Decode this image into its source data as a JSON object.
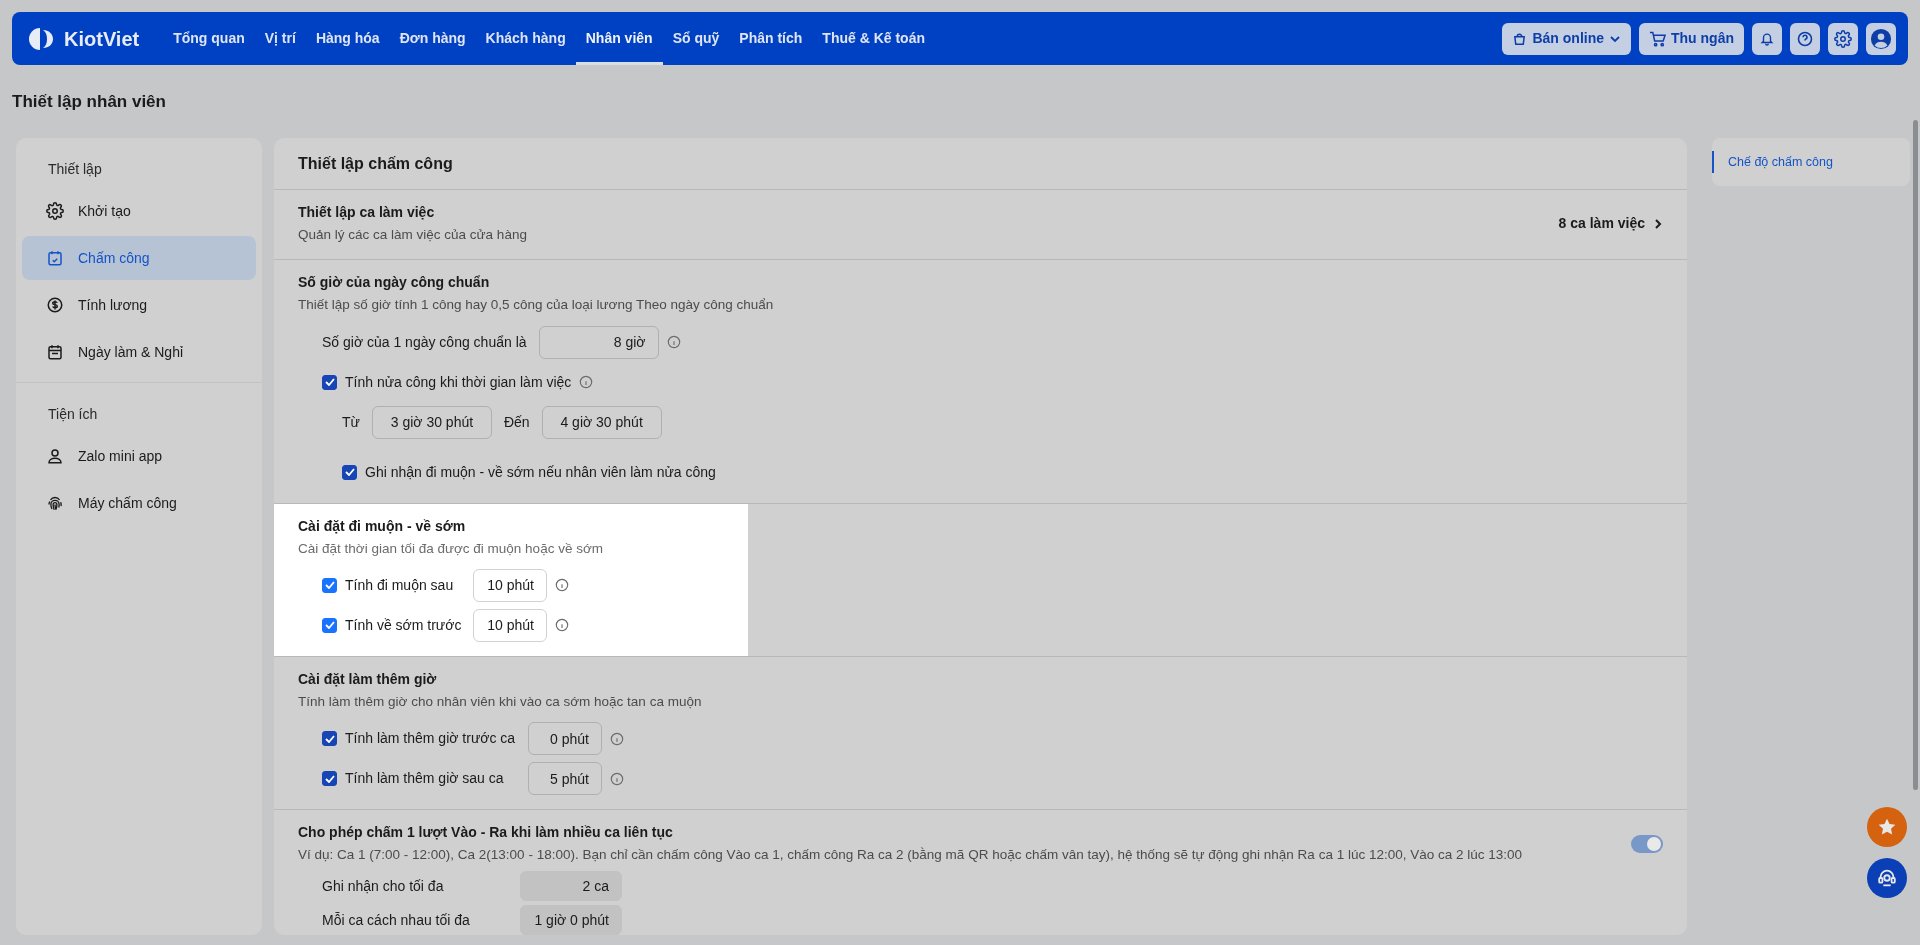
{
  "navbar": {
    "brand": "KiotViet",
    "menu": [
      {
        "label": "Tổng quan",
        "selected": false
      },
      {
        "label": "Vị trí",
        "selected": false
      },
      {
        "label": "Hàng hóa",
        "selected": false
      },
      {
        "label": "Đơn hàng",
        "selected": false
      },
      {
        "label": "Khách hàng",
        "selected": false
      },
      {
        "label": "Nhân viên",
        "selected": true
      },
      {
        "label": "Sổ quỹ",
        "selected": false
      },
      {
        "label": "Phân tích",
        "selected": false
      },
      {
        "label": "Thuế & Kế toán",
        "selected": false
      }
    ],
    "actions": [
      {
        "kind": "dropdown",
        "label": "Bán online"
      },
      {
        "kind": "button",
        "label": "Thu ngân"
      }
    ]
  },
  "page_title": "Thiết lập nhân viên",
  "sidebar": {
    "groups": [
      {
        "heading": "Thiết lập",
        "items": [
          {
            "label": "Khởi tạo",
            "selected": false
          },
          {
            "label": "Chấm công",
            "selected": true
          },
          {
            "label": "Tính lương",
            "selected": false
          },
          {
            "label": "Ngày làm & Nghỉ",
            "selected": false
          }
        ]
      },
      {
        "heading": "Tiện ích",
        "items": [
          {
            "label": "Zalo mini app",
            "selected": false
          },
          {
            "label": "Máy chấm công",
            "selected": false
          }
        ]
      }
    ]
  },
  "main": {
    "title": "Thiết lập chấm công",
    "sections": [
      {
        "title": "Thiết lập ca làm việc",
        "description": "Quản lý các ca làm việc của cửa hàng",
        "highlighted": false,
        "link": "8 ca làm việc"
      },
      {
        "title": "Số giờ của ngày công chuẩn",
        "description": "Thiết lập số giờ tính 1 công hay 0,5 công của loại lương Theo ngày công chuẩn",
        "highlighted": false,
        "rows": [
          {
            "kind": "field",
            "label": "Số giờ của 1 ngày công chuẩn là",
            "value": "8 giờ",
            "info": true
          },
          {
            "kind": "checkbox",
            "label": "Tính nửa công khi thời gian làm việc",
            "checked": true,
            "info": true
          },
          {
            "kind": "range",
            "from_label": "Từ",
            "from": "3 giờ 30 phút",
            "to_label": "Đến",
            "to": "4 giờ 30 phút"
          },
          {
            "kind": "subcheckbox",
            "label": "Ghi nhận đi muộn - về sớm nếu nhân viên làm nửa công",
            "checked": true
          }
        ]
      },
      {
        "title": "Cài đặt đi muộn - về sớm",
        "description": "Cài đặt thời gian tối đa được đi muộn hoặc về sớm",
        "highlighted": true,
        "rows": [
          {
            "kind": "checkfield",
            "label": "Tính đi muộn sau",
            "checked": true,
            "value": "10 phút",
            "info": true
          },
          {
            "kind": "checkfield",
            "label": "Tính về sớm trước",
            "checked": true,
            "value": "10 phút",
            "info": true
          }
        ]
      },
      {
        "title": "Cài đặt làm thêm giờ",
        "description": "Tính làm thêm giờ cho nhân viên khi vào ca sớm hoặc tan ca muộn",
        "highlighted": false,
        "rows": [
          {
            "kind": "checkfield",
            "label": "Tính làm thêm giờ trước ca",
            "checked": true,
            "value": "0 phút",
            "info": true
          },
          {
            "kind": "checkfield",
            "label": "Tính làm thêm giờ sau ca",
            "checked": true,
            "value": "5 phút",
            "info": true
          }
        ]
      },
      {
        "title": "Cho phép chấm 1 lượt Vào - Ra khi làm nhiều ca liên tục",
        "description": "Ví dụ: Ca 1 (7:00 - 12:00), Ca 2(13:00 - 18:00). Bạn chỉ cần chấm công Vào ca 1, chấm công Ra ca 2 (bằng mã QR hoặc chấm vân tay), hệ thống sẽ tự động ghi nhận Ra ca 1 lúc 12:00, Vào ca 2 lúc 13:00",
        "highlighted": false,
        "toggle": {
          "on": true
        },
        "rows": [
          {
            "kind": "plainfield",
            "label": "Ghi nhận cho tối đa",
            "value": "2 ca",
            "disabled": true
          },
          {
            "kind": "plainfield",
            "label": "Mỗi ca cách nhau tối đa",
            "value": "1 giờ 0 phút",
            "disabled": true
          }
        ]
      }
    ]
  },
  "toc": {
    "items": [
      {
        "label": "Chế độ chấm công",
        "selected": true
      }
    ]
  }
}
